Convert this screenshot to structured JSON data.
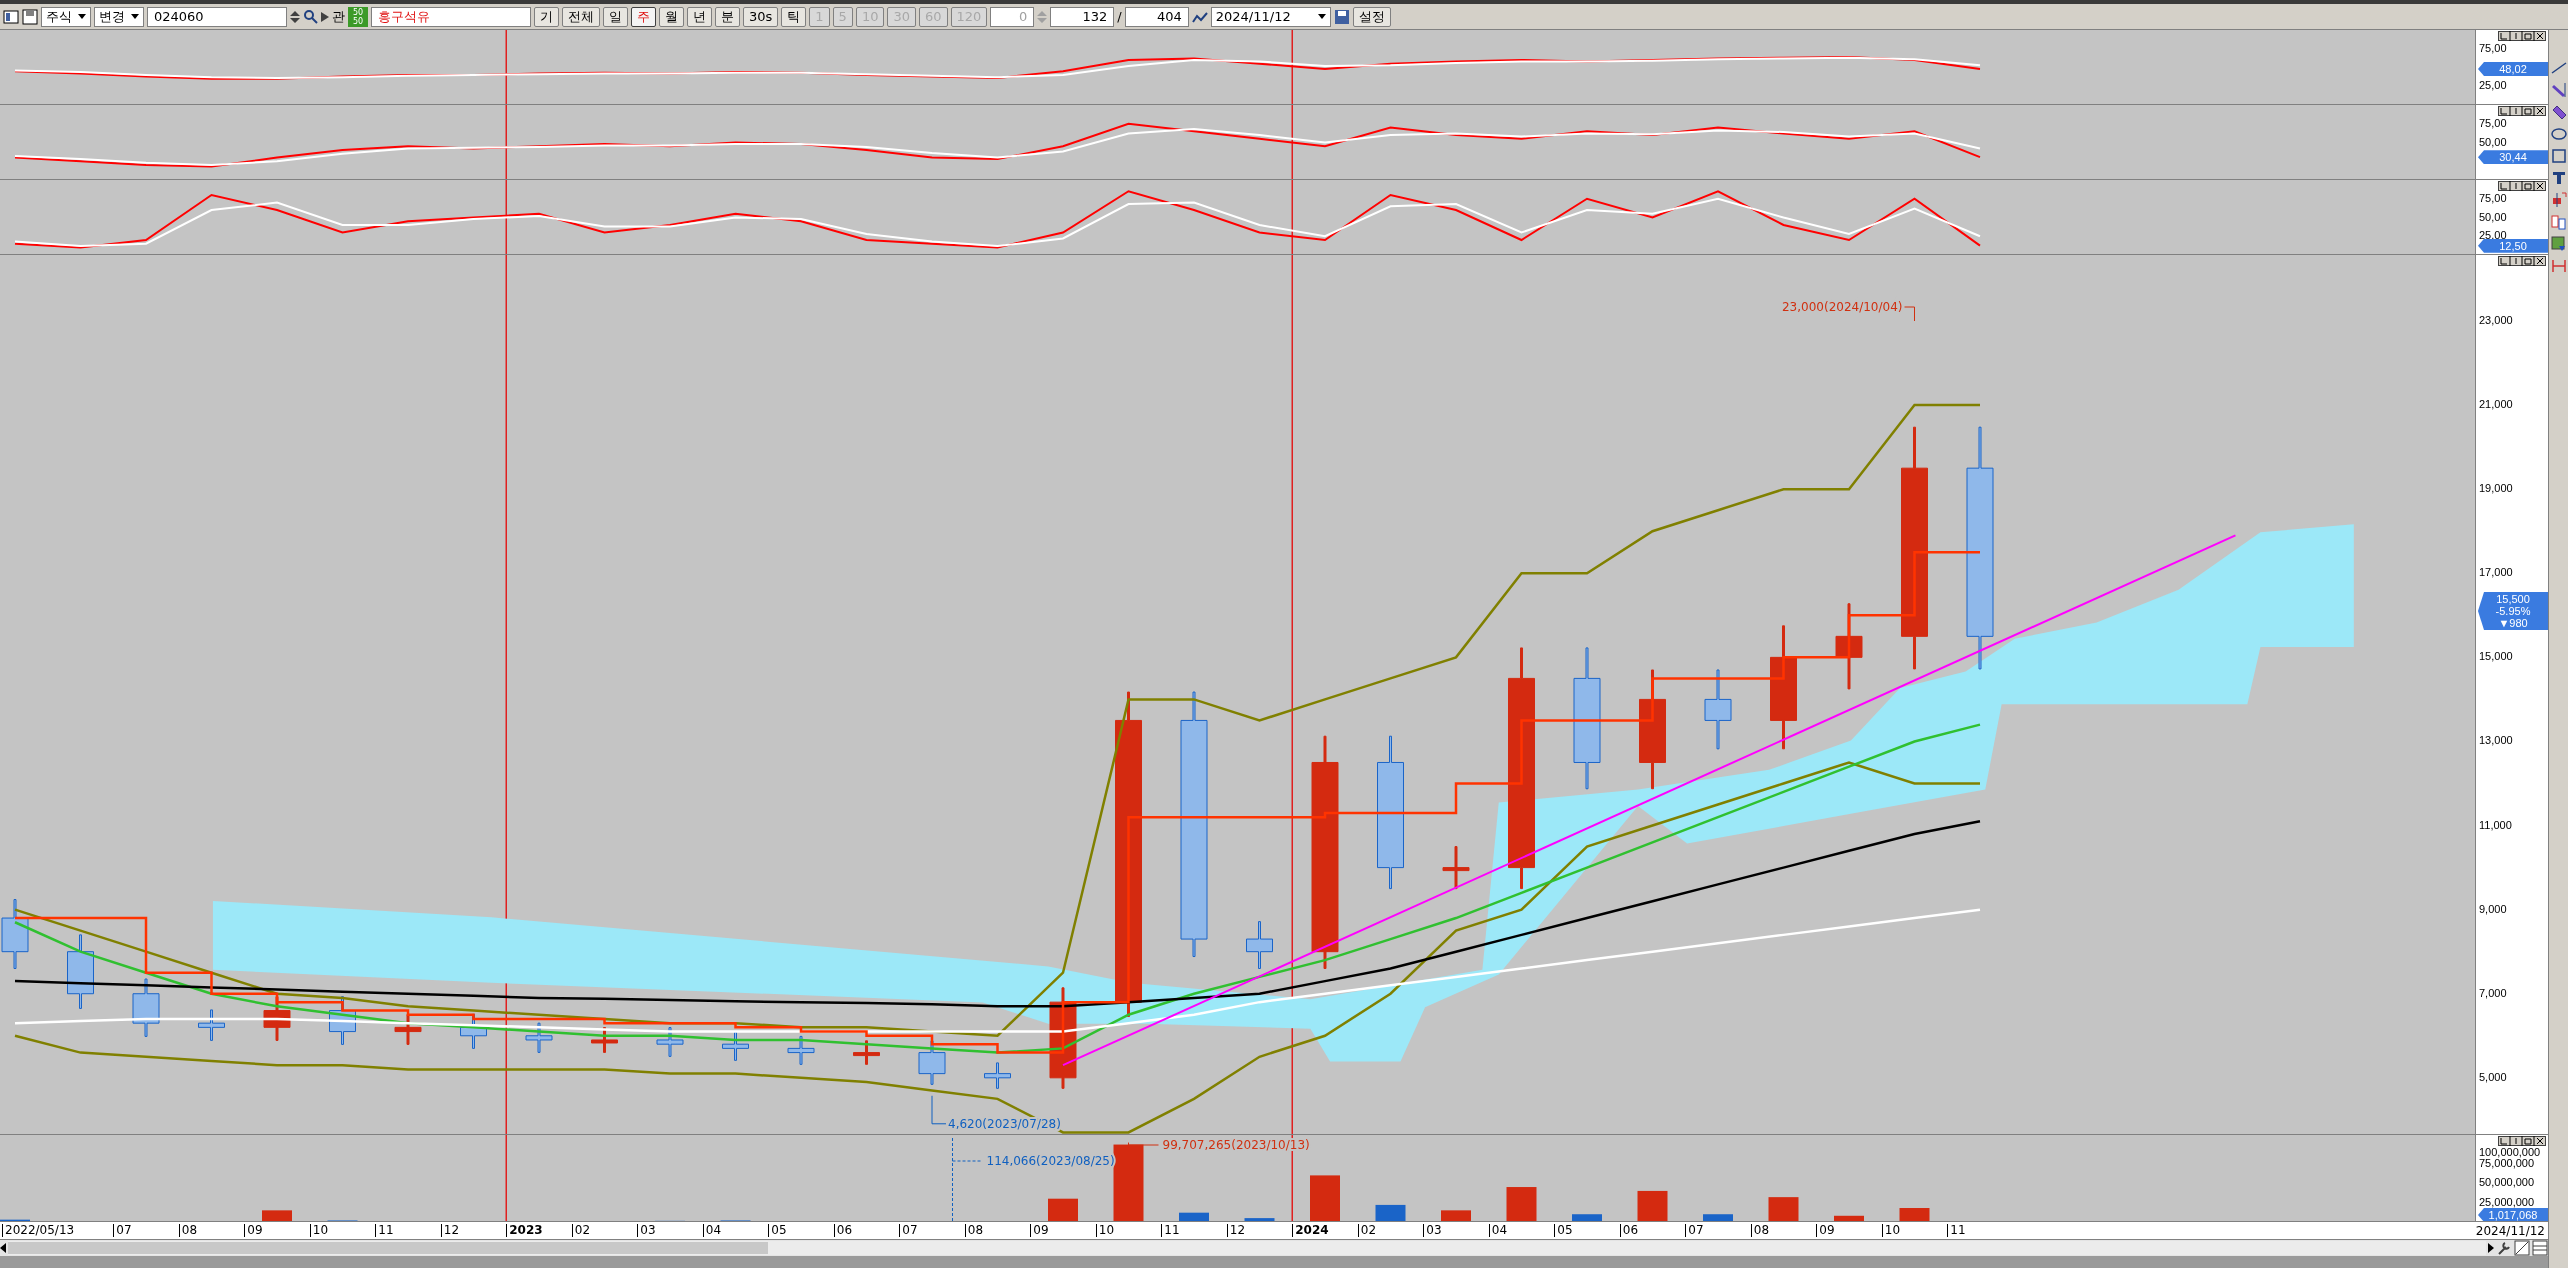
{
  "toolbar": {
    "market": "주식",
    "mode": "변경",
    "code": "024060",
    "prefix": "관",
    "badge": [
      "50",
      "50"
    ],
    "stock_name": "흥구석유",
    "buttons": [
      {
        "label": "기"
      },
      {
        "label": "전체"
      }
    ],
    "periods": [
      {
        "label": "일",
        "selected": false
      },
      {
        "label": "주",
        "selected": true
      },
      {
        "label": "월",
        "selected": false
      },
      {
        "label": "년",
        "selected": false
      },
      {
        "label": "분",
        "selected": false
      },
      {
        "label": "30s",
        "selected": false
      },
      {
        "label": "틱",
        "selected": false
      }
    ],
    "intervals": [
      {
        "label": "1",
        "disabled": true
      },
      {
        "label": "5",
        "disabled": true
      },
      {
        "label": "10",
        "disabled": true
      },
      {
        "label": "30",
        "disabled": true
      },
      {
        "label": "60",
        "disabled": true
      },
      {
        "label": "120",
        "disabled": true
      }
    ],
    "interval_value": "0",
    "count": "132",
    "separator": "/",
    "total": "404",
    "date": "2024/11/12",
    "settings": "설정"
  },
  "panels": [
    {
      "kind": "oscillator",
      "axis_labels": [
        "75,00",
        "25,00"
      ],
      "tag": [
        "48,02"
      ]
    },
    {
      "kind": "oscillator",
      "axis_labels": [
        "75,00",
        "50,00"
      ],
      "tag": [
        "30,44"
      ]
    },
    {
      "kind": "oscillator",
      "axis_labels": [
        "75,00",
        "50,00",
        "25,00"
      ],
      "tag": [
        "12,50"
      ]
    },
    {
      "kind": "price",
      "axis_labels": [
        "23,000",
        "21,000",
        "19,000",
        "17,000",
        "15,000",
        "13,000",
        "11,000",
        "9,000",
        "7,000",
        "5,000"
      ],
      "tag": [
        "15,500",
        "-5.95%",
        "▼980"
      ],
      "annotations": [
        {
          "kind": "high",
          "text": "23,000(2024/10/04)"
        },
        {
          "kind": "low",
          "text": "4,620(2023/07/28)"
        }
      ]
    },
    {
      "kind": "volume",
      "axis_labels": [
        "100,000,000",
        "75,000,000",
        "50,000,000",
        "25,000,000"
      ],
      "tag": [
        "1,017,068"
      ],
      "annotations": [
        {
          "kind": "high",
          "text": "99,707,265(2023/10/13)"
        },
        {
          "kind": "low",
          "text": "114,066(2023/08/25)"
        }
      ]
    }
  ],
  "x_axis": {
    "ticks": [
      {
        "label": "2022/05/13",
        "kind": "start"
      },
      {
        "label": "07",
        "kind": "month"
      },
      {
        "label": "08",
        "kind": "month"
      },
      {
        "label": "09",
        "kind": "month"
      },
      {
        "label": "10",
        "kind": "month"
      },
      {
        "label": "11",
        "kind": "month"
      },
      {
        "label": "12",
        "kind": "month"
      },
      {
        "label": "2023",
        "kind": "year"
      },
      {
        "label": "02",
        "kind": "month"
      },
      {
        "label": "03",
        "kind": "month"
      },
      {
        "label": "04",
        "kind": "month"
      },
      {
        "label": "05",
        "kind": "month"
      },
      {
        "label": "06",
        "kind": "month"
      },
      {
        "label": "07",
        "kind": "month"
      },
      {
        "label": "08",
        "kind": "month"
      },
      {
        "label": "09",
        "kind": "month"
      },
      {
        "label": "10",
        "kind": "month"
      },
      {
        "label": "11",
        "kind": "month"
      },
      {
        "label": "12",
        "kind": "month"
      },
      {
        "label": "2024",
        "kind": "year"
      },
      {
        "label": "02",
        "kind": "month"
      },
      {
        "label": "03",
        "kind": "month"
      },
      {
        "label": "04",
        "kind": "month"
      },
      {
        "label": "05",
        "kind": "month"
      },
      {
        "label": "06",
        "kind": "month"
      },
      {
        "label": "07",
        "kind": "month"
      },
      {
        "label": "08",
        "kind": "month"
      },
      {
        "label": "09",
        "kind": "month"
      },
      {
        "label": "10",
        "kind": "month"
      },
      {
        "label": "11",
        "kind": "month"
      }
    ],
    "end_label": "2024/11/12"
  }
}
